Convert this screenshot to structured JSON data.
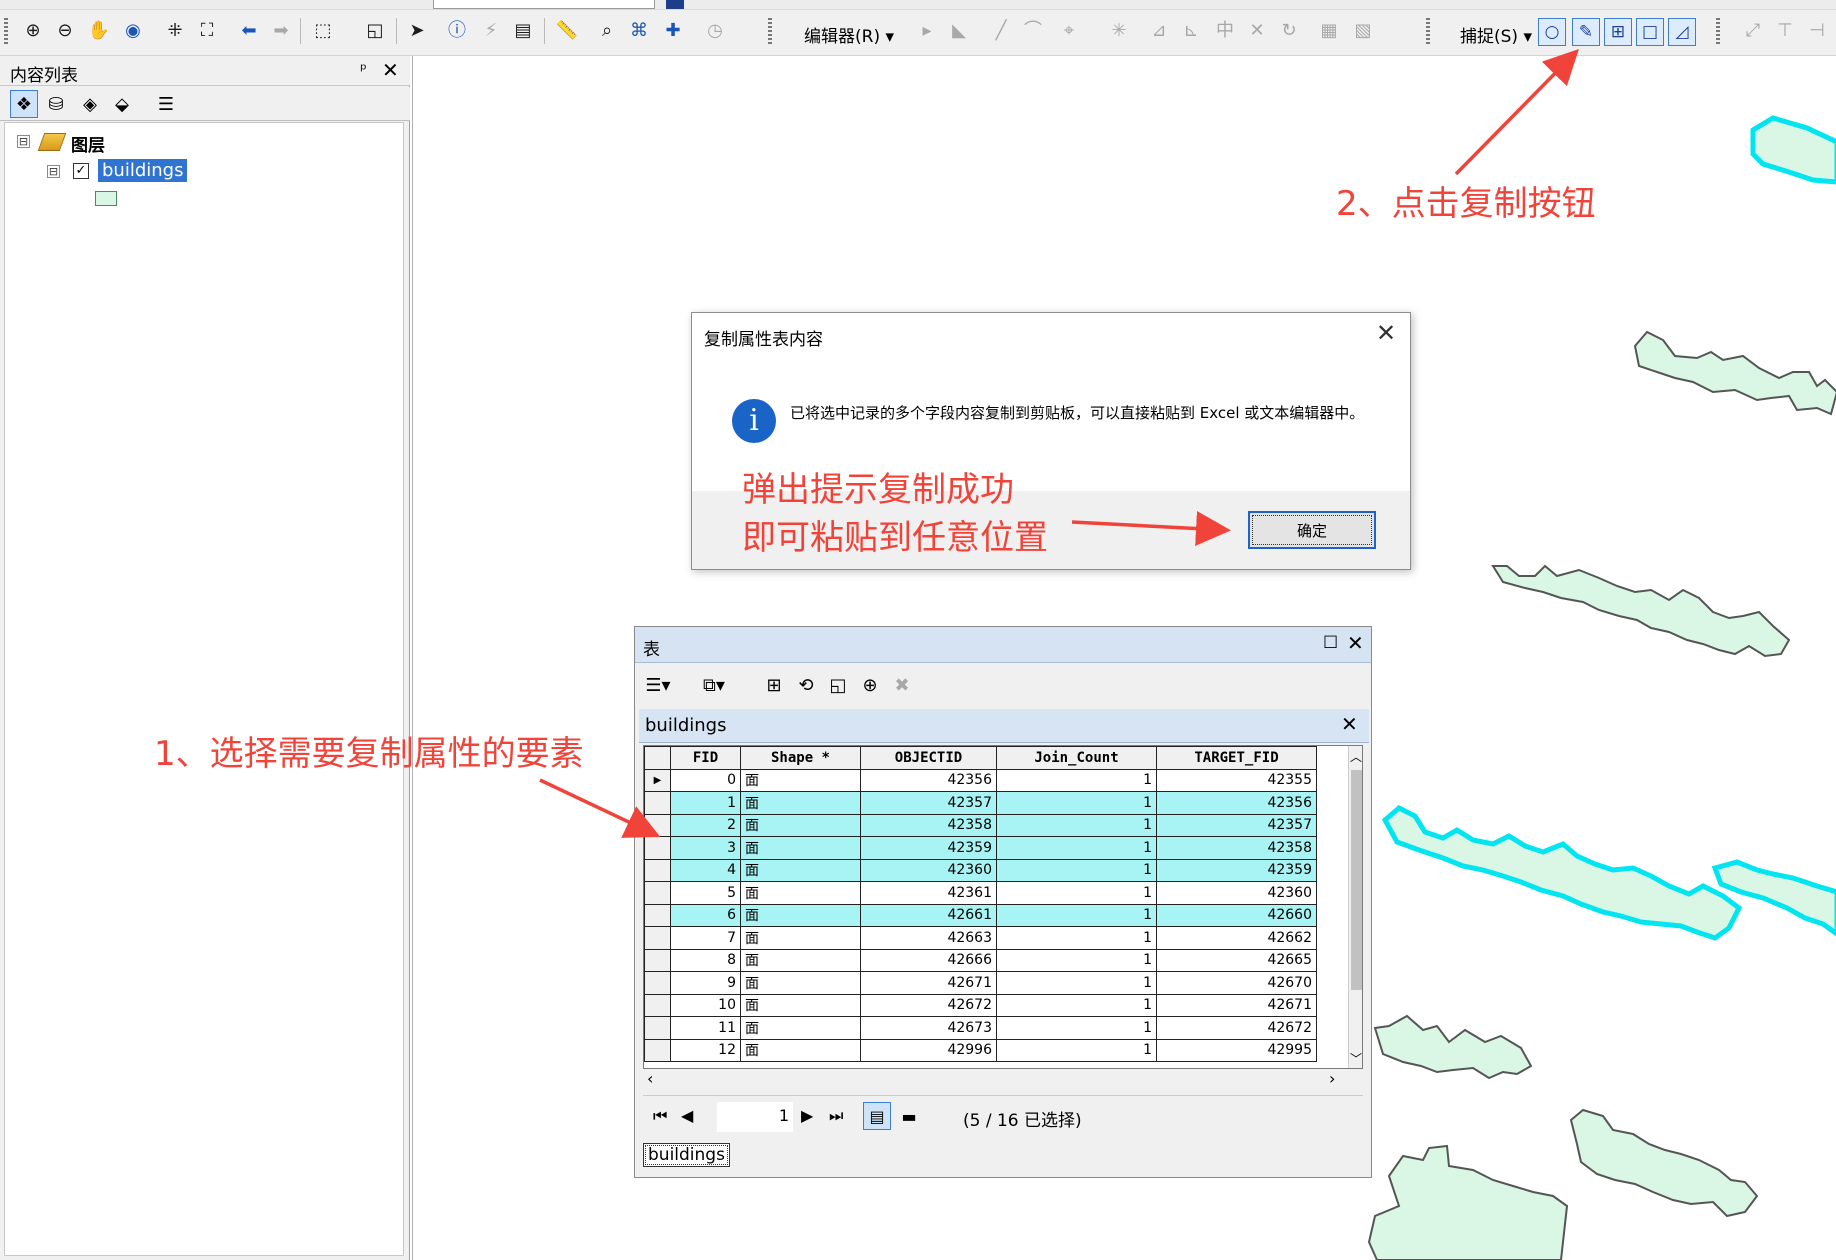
{
  "toolbar": {
    "editor_label": "编辑器(R) ▾",
    "snapping_label": "捕捉(S) ▾"
  },
  "toc": {
    "title": "内容列表",
    "pin": "ᵖ",
    "close": "✕",
    "root_label": "图层",
    "layer_name": "buildings",
    "layer_checked": "✓",
    "expand_symbol": "⊟"
  },
  "dialog": {
    "title": "复制属性表内容",
    "close": "✕",
    "info_glyph": "i",
    "message": "已将选中记录的多个字段内容复制到剪贴板，可以直接粘贴到 Excel 或文本编辑器中。",
    "ok_label": "确定"
  },
  "table_window": {
    "title": "表",
    "max": "☐",
    "close": "✕",
    "tab_name": "buildings",
    "tab_close": "✕",
    "columns": [
      "",
      "FID",
      "Shape *",
      "OBJECTID",
      "Join_Count",
      "TARGET_FID"
    ],
    "rows": [
      {
        "fid": "0",
        "shape": "面",
        "objectid": "42356",
        "join": "1",
        "target": "42355",
        "selected": false,
        "current": true
      },
      {
        "fid": "1",
        "shape": "面",
        "objectid": "42357",
        "join": "1",
        "target": "42356",
        "selected": true,
        "current": false
      },
      {
        "fid": "2",
        "shape": "面",
        "objectid": "42358",
        "join": "1",
        "target": "42357",
        "selected": true,
        "current": false
      },
      {
        "fid": "3",
        "shape": "面",
        "objectid": "42359",
        "join": "1",
        "target": "42358",
        "selected": true,
        "current": false
      },
      {
        "fid": "4",
        "shape": "面",
        "objectid": "42360",
        "join": "1",
        "target": "42359",
        "selected": true,
        "current": false
      },
      {
        "fid": "5",
        "shape": "面",
        "objectid": "42361",
        "join": "1",
        "target": "42360",
        "selected": false,
        "current": false
      },
      {
        "fid": "6",
        "shape": "面",
        "objectid": "42661",
        "join": "1",
        "target": "42660",
        "selected": true,
        "current": false
      },
      {
        "fid": "7",
        "shape": "面",
        "objectid": "42663",
        "join": "1",
        "target": "42662",
        "selected": false,
        "current": false
      },
      {
        "fid": "8",
        "shape": "面",
        "objectid": "42666",
        "join": "1",
        "target": "42665",
        "selected": false,
        "current": false
      },
      {
        "fid": "9",
        "shape": "面",
        "objectid": "42671",
        "join": "1",
        "target": "42670",
        "selected": false,
        "current": false
      },
      {
        "fid": "10",
        "shape": "面",
        "objectid": "42672",
        "join": "1",
        "target": "42671",
        "selected": false,
        "current": false
      },
      {
        "fid": "11",
        "shape": "面",
        "objectid": "42673",
        "join": "1",
        "target": "42672",
        "selected": false,
        "current": false
      },
      {
        "fid": "12",
        "shape": "面",
        "objectid": "42996",
        "join": "1",
        "target": "42995",
        "selected": false,
        "current": false
      }
    ],
    "current_page": "1",
    "status": "(5 / 16 已选择)",
    "bottom_tab": "buildings"
  },
  "annotations": {
    "step1": "1、选择需要复制属性的要素",
    "step2": "2、点击复制按钮",
    "step3_line1": "弹出提示复制成功",
    "step3_line2": "即可粘贴到任意位置"
  },
  "colors": {
    "annotation_red": "#f0443a",
    "selection_cyan": "#a8f4f4",
    "building_fill": "#d9f7e4",
    "selected_outline": "#00e5f0"
  }
}
